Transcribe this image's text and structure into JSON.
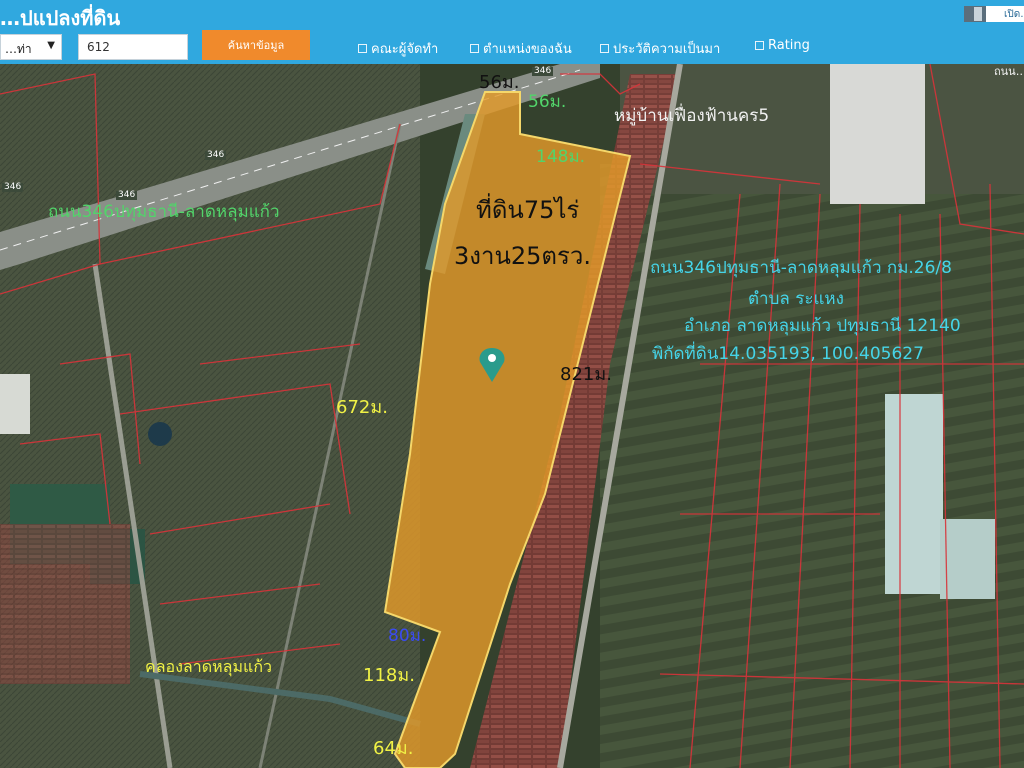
{
  "header": {
    "title": "…ปแปลงที่ดิน",
    "province_value": "…ท่า",
    "parcel_value": "612",
    "search_label": "ค้นหาข้อมูล",
    "toggles": [
      {
        "label": "คณะผู้จัดทำ"
      },
      {
        "label": "ตำแหน่งของฉัน"
      },
      {
        "label": "ประวัติความเป็นมา"
      },
      {
        "label": "Rating"
      }
    ],
    "open_toggle_label": "เปิด…"
  },
  "map": {
    "measurements": {
      "top_edge": "56ม.",
      "top_notch": "56ม.",
      "northeast_edge": "148ม.",
      "east_edge": "821ม.",
      "west_edge": "672ม.",
      "southwest_step": "80ม.",
      "south_west_edge": "118ม.",
      "south_edge": "64ม."
    },
    "area_line1": "ที่ดิน75ไร่",
    "area_line2": "3งาน25ตรว.",
    "village_label": "หมู่บ้านเฟื่องฟ้านคร5",
    "road_label_left": "ถนน346ปทุมธานี-ลาดหลุมแก้ว",
    "canal_label": "คลองลาดหลุมแก้ว",
    "info": {
      "line1": "ถนน346ปทุมธานี-ลาดหลุมแก้ว กม.26/8",
      "line2": "ตำบล ระแหง",
      "line3": "อำเภอ ลาดหลุมแก้ว ปทุมธานี 12140",
      "line4": "พิกัดที่ดิน14.035193, 100.405627"
    },
    "road_markers": [
      "346",
      "346",
      "346",
      "346"
    ],
    "top_right_partial": "ถนน…",
    "parcel_fill_color": "#e39a2a",
    "parcel_border_color": "#f5d76a",
    "boundary_color": "#d8333a",
    "pin_color": "#2a9b8c"
  }
}
